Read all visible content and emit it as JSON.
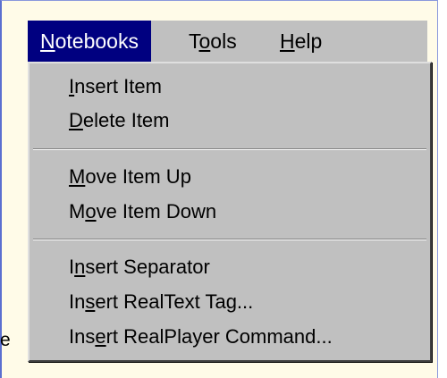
{
  "background_text": "e",
  "menubar": {
    "items": [
      {
        "pre": "",
        "key": "N",
        "post": "otebooks",
        "active": true
      },
      {
        "pre": "T",
        "key": "o",
        "post": "ols",
        "active": false
      },
      {
        "pre": "",
        "key": "H",
        "post": "elp",
        "active": false
      }
    ]
  },
  "menu": {
    "items": [
      {
        "pre": "",
        "key": "I",
        "post": "nsert Item"
      },
      {
        "pre": "",
        "key": "D",
        "post": "elete Item"
      },
      {
        "pre": "",
        "key": "M",
        "post": "ove Item Up"
      },
      {
        "pre": "M",
        "key": "o",
        "post": "ve Item Down"
      },
      {
        "pre": "I",
        "key": "n",
        "post": "sert Separator"
      },
      {
        "pre": "In",
        "key": "s",
        "post": "ert RealText Tag..."
      },
      {
        "pre": "Ins",
        "key": "e",
        "post": "rt RealPlayer Command..."
      }
    ]
  },
  "colors": {
    "menu_face": "#c0c0c0",
    "highlight": "#000080",
    "highlight_text": "#ffffff",
    "page_background": "#fffbe8"
  }
}
